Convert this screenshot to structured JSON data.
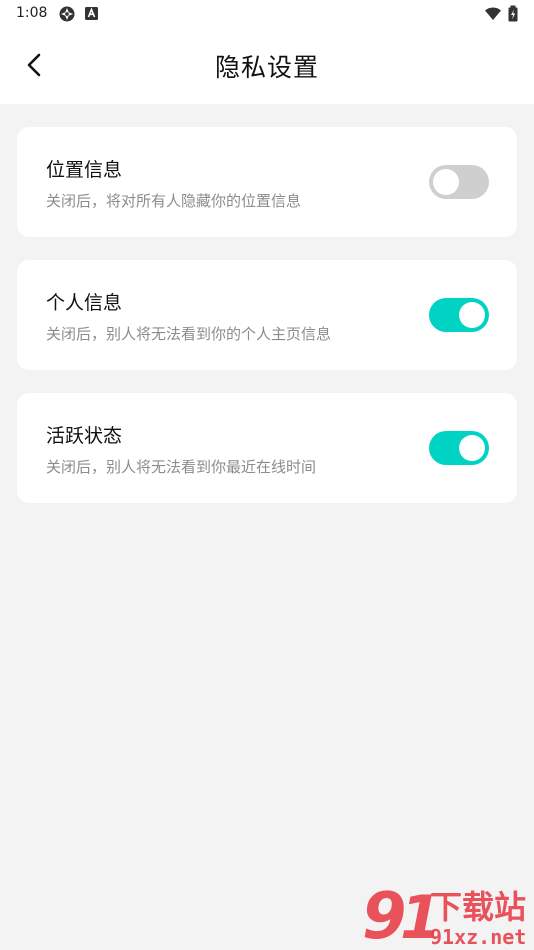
{
  "status_bar": {
    "time": "1:08"
  },
  "header": {
    "title": "隐私设置"
  },
  "settings": [
    {
      "title": "位置信息",
      "description": "关闭后，将对所有人隐藏你的位置信息",
      "enabled": false
    },
    {
      "title": "个人信息",
      "description": "关闭后，别人将无法看到你的个人主页信息",
      "enabled": true
    },
    {
      "title": "活跃状态",
      "description": "关闭后，别人将无法看到你最近在线时间",
      "enabled": true
    }
  ],
  "watermark": {
    "text_cn": "下载站",
    "text_url": "91xz.net"
  },
  "colors": {
    "toggle_on": "#00d2c3",
    "toggle_off": "#cfcfcf",
    "watermark_red": "#e8414b"
  },
  "icons": [
    "settings-icon",
    "a-notification-icon",
    "wifi-icon",
    "battery-icon",
    "back-arrow-icon"
  ]
}
